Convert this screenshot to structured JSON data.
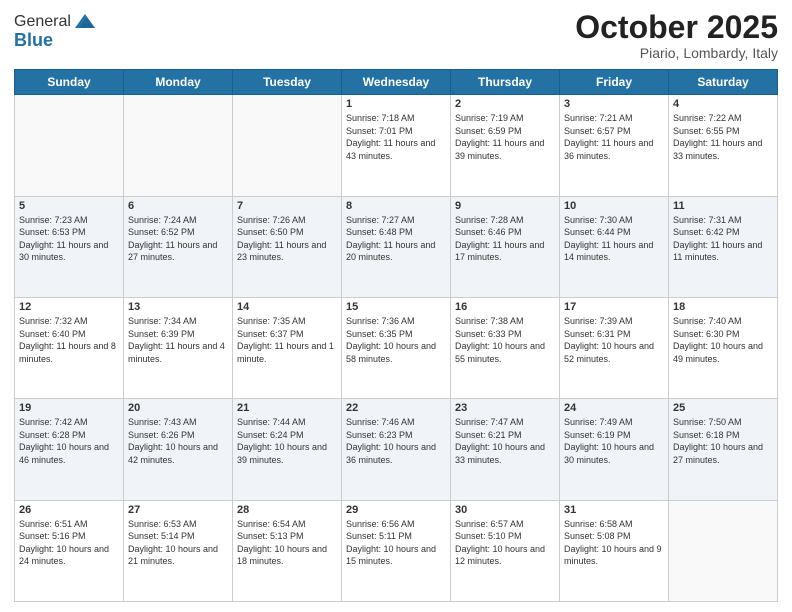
{
  "logo": {
    "general": "General",
    "blue": "Blue"
  },
  "header": {
    "month": "October 2025",
    "location": "Piario, Lombardy, Italy"
  },
  "days_of_week": [
    "Sunday",
    "Monday",
    "Tuesday",
    "Wednesday",
    "Thursday",
    "Friday",
    "Saturday"
  ],
  "weeks": [
    {
      "shaded": false,
      "days": [
        {
          "num": "",
          "sunrise": "",
          "sunset": "",
          "daylight": ""
        },
        {
          "num": "",
          "sunrise": "",
          "sunset": "",
          "daylight": ""
        },
        {
          "num": "",
          "sunrise": "",
          "sunset": "",
          "daylight": ""
        },
        {
          "num": "1",
          "sunrise": "Sunrise: 7:18 AM",
          "sunset": "Sunset: 7:01 PM",
          "daylight": "Daylight: 11 hours and 43 minutes."
        },
        {
          "num": "2",
          "sunrise": "Sunrise: 7:19 AM",
          "sunset": "Sunset: 6:59 PM",
          "daylight": "Daylight: 11 hours and 39 minutes."
        },
        {
          "num": "3",
          "sunrise": "Sunrise: 7:21 AM",
          "sunset": "Sunset: 6:57 PM",
          "daylight": "Daylight: 11 hours and 36 minutes."
        },
        {
          "num": "4",
          "sunrise": "Sunrise: 7:22 AM",
          "sunset": "Sunset: 6:55 PM",
          "daylight": "Daylight: 11 hours and 33 minutes."
        }
      ]
    },
    {
      "shaded": true,
      "days": [
        {
          "num": "5",
          "sunrise": "Sunrise: 7:23 AM",
          "sunset": "Sunset: 6:53 PM",
          "daylight": "Daylight: 11 hours and 30 minutes."
        },
        {
          "num": "6",
          "sunrise": "Sunrise: 7:24 AM",
          "sunset": "Sunset: 6:52 PM",
          "daylight": "Daylight: 11 hours and 27 minutes."
        },
        {
          "num": "7",
          "sunrise": "Sunrise: 7:26 AM",
          "sunset": "Sunset: 6:50 PM",
          "daylight": "Daylight: 11 hours and 23 minutes."
        },
        {
          "num": "8",
          "sunrise": "Sunrise: 7:27 AM",
          "sunset": "Sunset: 6:48 PM",
          "daylight": "Daylight: 11 hours and 20 minutes."
        },
        {
          "num": "9",
          "sunrise": "Sunrise: 7:28 AM",
          "sunset": "Sunset: 6:46 PM",
          "daylight": "Daylight: 11 hours and 17 minutes."
        },
        {
          "num": "10",
          "sunrise": "Sunrise: 7:30 AM",
          "sunset": "Sunset: 6:44 PM",
          "daylight": "Daylight: 11 hours and 14 minutes."
        },
        {
          "num": "11",
          "sunrise": "Sunrise: 7:31 AM",
          "sunset": "Sunset: 6:42 PM",
          "daylight": "Daylight: 11 hours and 11 minutes."
        }
      ]
    },
    {
      "shaded": false,
      "days": [
        {
          "num": "12",
          "sunrise": "Sunrise: 7:32 AM",
          "sunset": "Sunset: 6:40 PM",
          "daylight": "Daylight: 11 hours and 8 minutes."
        },
        {
          "num": "13",
          "sunrise": "Sunrise: 7:34 AM",
          "sunset": "Sunset: 6:39 PM",
          "daylight": "Daylight: 11 hours and 4 minutes."
        },
        {
          "num": "14",
          "sunrise": "Sunrise: 7:35 AM",
          "sunset": "Sunset: 6:37 PM",
          "daylight": "Daylight: 11 hours and 1 minute."
        },
        {
          "num": "15",
          "sunrise": "Sunrise: 7:36 AM",
          "sunset": "Sunset: 6:35 PM",
          "daylight": "Daylight: 10 hours and 58 minutes."
        },
        {
          "num": "16",
          "sunrise": "Sunrise: 7:38 AM",
          "sunset": "Sunset: 6:33 PM",
          "daylight": "Daylight: 10 hours and 55 minutes."
        },
        {
          "num": "17",
          "sunrise": "Sunrise: 7:39 AM",
          "sunset": "Sunset: 6:31 PM",
          "daylight": "Daylight: 10 hours and 52 minutes."
        },
        {
          "num": "18",
          "sunrise": "Sunrise: 7:40 AM",
          "sunset": "Sunset: 6:30 PM",
          "daylight": "Daylight: 10 hours and 49 minutes."
        }
      ]
    },
    {
      "shaded": true,
      "days": [
        {
          "num": "19",
          "sunrise": "Sunrise: 7:42 AM",
          "sunset": "Sunset: 6:28 PM",
          "daylight": "Daylight: 10 hours and 46 minutes."
        },
        {
          "num": "20",
          "sunrise": "Sunrise: 7:43 AM",
          "sunset": "Sunset: 6:26 PM",
          "daylight": "Daylight: 10 hours and 42 minutes."
        },
        {
          "num": "21",
          "sunrise": "Sunrise: 7:44 AM",
          "sunset": "Sunset: 6:24 PM",
          "daylight": "Daylight: 10 hours and 39 minutes."
        },
        {
          "num": "22",
          "sunrise": "Sunrise: 7:46 AM",
          "sunset": "Sunset: 6:23 PM",
          "daylight": "Daylight: 10 hours and 36 minutes."
        },
        {
          "num": "23",
          "sunrise": "Sunrise: 7:47 AM",
          "sunset": "Sunset: 6:21 PM",
          "daylight": "Daylight: 10 hours and 33 minutes."
        },
        {
          "num": "24",
          "sunrise": "Sunrise: 7:49 AM",
          "sunset": "Sunset: 6:19 PM",
          "daylight": "Daylight: 10 hours and 30 minutes."
        },
        {
          "num": "25",
          "sunrise": "Sunrise: 7:50 AM",
          "sunset": "Sunset: 6:18 PM",
          "daylight": "Daylight: 10 hours and 27 minutes."
        }
      ]
    },
    {
      "shaded": false,
      "days": [
        {
          "num": "26",
          "sunrise": "Sunrise: 6:51 AM",
          "sunset": "Sunset: 5:16 PM",
          "daylight": "Daylight: 10 hours and 24 minutes."
        },
        {
          "num": "27",
          "sunrise": "Sunrise: 6:53 AM",
          "sunset": "Sunset: 5:14 PM",
          "daylight": "Daylight: 10 hours and 21 minutes."
        },
        {
          "num": "28",
          "sunrise": "Sunrise: 6:54 AM",
          "sunset": "Sunset: 5:13 PM",
          "daylight": "Daylight: 10 hours and 18 minutes."
        },
        {
          "num": "29",
          "sunrise": "Sunrise: 6:56 AM",
          "sunset": "Sunset: 5:11 PM",
          "daylight": "Daylight: 10 hours and 15 minutes."
        },
        {
          "num": "30",
          "sunrise": "Sunrise: 6:57 AM",
          "sunset": "Sunset: 5:10 PM",
          "daylight": "Daylight: 10 hours and 12 minutes."
        },
        {
          "num": "31",
          "sunrise": "Sunrise: 6:58 AM",
          "sunset": "Sunset: 5:08 PM",
          "daylight": "Daylight: 10 hours and 9 minutes."
        },
        {
          "num": "",
          "sunrise": "",
          "sunset": "",
          "daylight": ""
        }
      ]
    }
  ]
}
